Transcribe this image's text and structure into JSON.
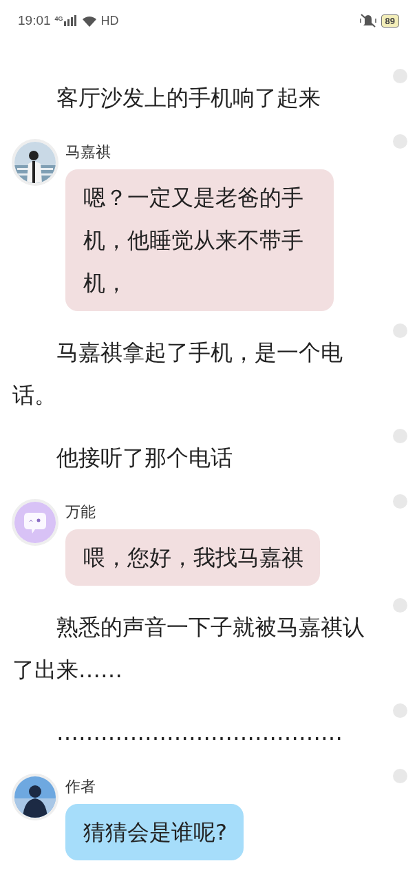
{
  "status_bar": {
    "time": "19:01",
    "network": "4G",
    "hd": "HD",
    "battery": "89"
  },
  "items": [
    {
      "kind": "narration",
      "text": "客厅沙发上的手机响了起来"
    },
    {
      "kind": "chat",
      "name": "马嘉祺",
      "color": "#f2dfe0",
      "text": "嗯？一定又是老爸的手机，他睡觉从来不带手机，"
    },
    {
      "kind": "narration",
      "text": "马嘉祺拿起了手机，是一个电话。"
    },
    {
      "kind": "narration",
      "text": "他接听了那个电话"
    },
    {
      "kind": "chat",
      "name": "万能",
      "avatar": {
        "kind": "icon"
      },
      "color": "#f2dfe0",
      "text": "喂，您好，我找马嘉祺"
    },
    {
      "kind": "narration",
      "text": "熟悉的声音一下子就被马嘉祺认了出来……"
    },
    {
      "kind": "narration",
      "text": "…………………………………"
    },
    {
      "kind": "chat",
      "name": "作者",
      "color": "#a6ddfa",
      "text": "猜猜会是谁呢?"
    }
  ]
}
